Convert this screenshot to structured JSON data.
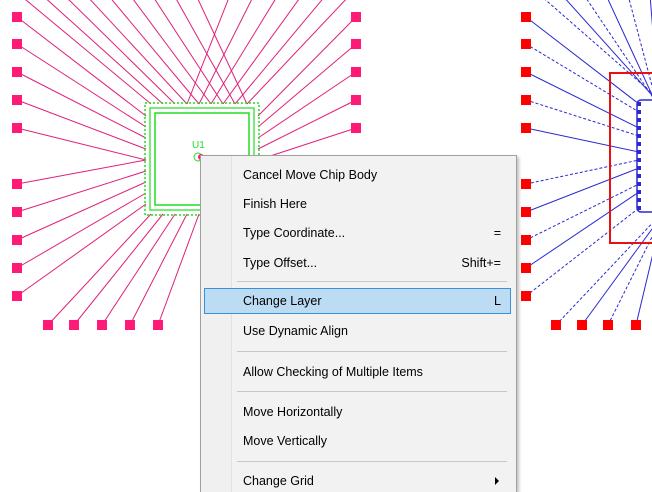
{
  "context_menu": {
    "items": [
      {
        "label": "Cancel Move Chip Body",
        "shortcut": ""
      },
      {
        "label": "Finish Here",
        "shortcut": ""
      },
      {
        "label": "Type Coordinate...",
        "shortcut": "="
      },
      {
        "label": "Type Offset...",
        "shortcut": "Shift+="
      },
      {
        "label": "Change Layer",
        "shortcut": "L",
        "highlighted": true
      },
      {
        "label": "Use Dynamic Align",
        "shortcut": ""
      },
      {
        "label": "Allow Checking of Multiple Items",
        "shortcut": ""
      },
      {
        "label": "Move Horizontally",
        "shortcut": ""
      },
      {
        "label": "Move Vertically",
        "shortcut": ""
      },
      {
        "label": "Change Grid",
        "shortcut": "",
        "submenu": true
      }
    ]
  },
  "canvas": {
    "chip_label": "U1",
    "colors": {
      "left_pads": "#ff1a75",
      "left_wires": "#e0207a",
      "left_chip_outline": "#22dd22",
      "right_pads": "#ff0000",
      "right_wires": "#2a2ad0",
      "right_chip_outline": "#e81010",
      "menu_highlight": "#bcdcf4",
      "menu_highlight_border": "#3b91d9"
    }
  }
}
